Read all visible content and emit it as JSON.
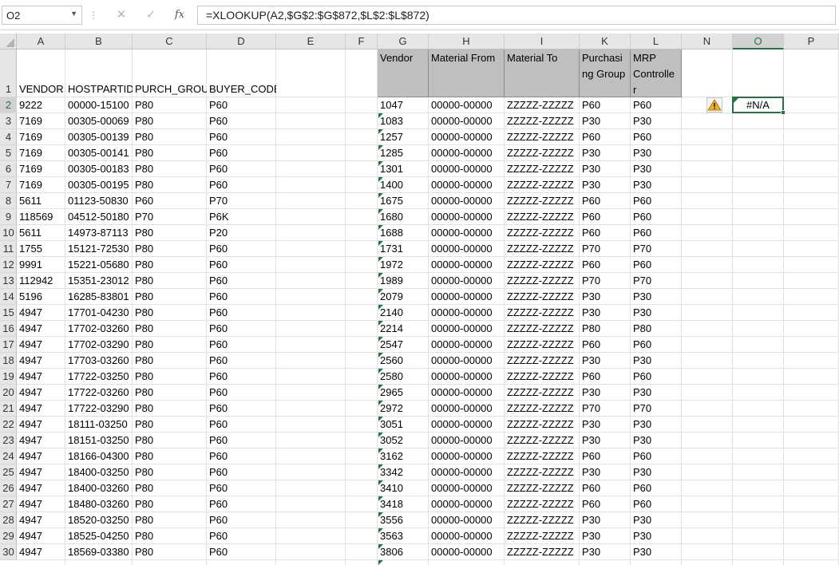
{
  "name_box": {
    "value": "O2",
    "dropdown_icon": "chevron-down-icon"
  },
  "formula_bar": {
    "separator": "⋮",
    "cancel_icon": "close-icon",
    "enter_icon": "check-icon",
    "fx_label": "fx",
    "formula": "=XLOOKUP(A2,$G$2:$G$872,$L$2:$L$872)"
  },
  "columns": [
    "A",
    "B",
    "C",
    "D",
    "E",
    "F",
    "G",
    "H",
    "I",
    "K",
    "L",
    "N",
    "O",
    "P"
  ],
  "active_column": "O",
  "active_row": 2,
  "row_numbers": [
    1,
    2,
    3,
    4,
    5,
    6,
    7,
    8,
    9,
    10,
    11,
    12,
    13,
    14,
    15,
    16,
    17,
    18,
    19,
    20,
    21,
    22,
    23,
    24,
    25,
    26,
    27,
    28,
    29,
    30
  ],
  "left_table": {
    "headers": [
      "VENDOR",
      "HOSTPARTID",
      "PURCH_GROUP",
      "BUYER_CODE"
    ],
    "rows": [
      [
        "9222",
        "00000-15100",
        "P80",
        "P60"
      ],
      [
        "7169",
        "00305-00069",
        "P80",
        "P60"
      ],
      [
        "7169",
        "00305-00139",
        "P80",
        "P60"
      ],
      [
        "7169",
        "00305-00141",
        "P80",
        "P60"
      ],
      [
        "7169",
        "00305-00183",
        "P80",
        "P60"
      ],
      [
        "7169",
        "00305-00195",
        "P80",
        "P60"
      ],
      [
        "5611",
        "01123-50830",
        "P60",
        "P70"
      ],
      [
        "118569",
        "04512-50180",
        "P70",
        "P6K"
      ],
      [
        "5611",
        "14973-87113",
        "P80",
        "P20"
      ],
      [
        "1755",
        "15121-72530",
        "P80",
        "P60"
      ],
      [
        "9991",
        "15221-05680",
        "P80",
        "P60"
      ],
      [
        "112942",
        "15351-23012",
        "P80",
        "P60"
      ],
      [
        "5196",
        "16285-83801",
        "P80",
        "P60"
      ],
      [
        "4947",
        "17701-04230",
        "P80",
        "P60"
      ],
      [
        "4947",
        "17702-03260",
        "P80",
        "P60"
      ],
      [
        "4947",
        "17702-03290",
        "P80",
        "P60"
      ],
      [
        "4947",
        "17703-03260",
        "P80",
        "P60"
      ],
      [
        "4947",
        "17722-03250",
        "P80",
        "P60"
      ],
      [
        "4947",
        "17722-03260",
        "P80",
        "P60"
      ],
      [
        "4947",
        "17722-03290",
        "P80",
        "P60"
      ],
      [
        "4947",
        "18111-03250",
        "P80",
        "P60"
      ],
      [
        "4947",
        "18151-03250",
        "P80",
        "P60"
      ],
      [
        "4947",
        "18166-04300",
        "P80",
        "P60"
      ],
      [
        "4947",
        "18400-03250",
        "P80",
        "P60"
      ],
      [
        "4947",
        "18400-03260",
        "P80",
        "P60"
      ],
      [
        "4947",
        "18480-03260",
        "P80",
        "P60"
      ],
      [
        "4947",
        "18520-03250",
        "P80",
        "P60"
      ],
      [
        "4947",
        "18525-04250",
        "P80",
        "P60"
      ],
      [
        "4947",
        "18569-03380",
        "P80",
        "P60"
      ]
    ]
  },
  "right_table": {
    "headers": [
      [
        "Vendor"
      ],
      [
        "Material From"
      ],
      [
        "Material To"
      ],
      [
        "Purchasi",
        "ng Group"
      ],
      [
        "MRP",
        "Controlle",
        "r"
      ]
    ],
    "rows": [
      [
        "1047",
        "00000-00000",
        "ZZZZZ-ZZZZZ",
        "P60",
        "P60"
      ],
      [
        "1083",
        "00000-00000",
        "ZZZZZ-ZZZZZ",
        "P30",
        "P30"
      ],
      [
        "1257",
        "00000-00000",
        "ZZZZZ-ZZZZZ",
        "P60",
        "P60"
      ],
      [
        "1285",
        "00000-00000",
        "ZZZZZ-ZZZZZ",
        "P30",
        "P30"
      ],
      [
        "1301",
        "00000-00000",
        "ZZZZZ-ZZZZZ",
        "P30",
        "P30"
      ],
      [
        "1400",
        "00000-00000",
        "ZZZZZ-ZZZZZ",
        "P30",
        "P30"
      ],
      [
        "1675",
        "00000-00000",
        "ZZZZZ-ZZZZZ",
        "P60",
        "P60"
      ],
      [
        "1680",
        "00000-00000",
        "ZZZZZ-ZZZZZ",
        "P60",
        "P60"
      ],
      [
        "1688",
        "00000-00000",
        "ZZZZZ-ZZZZZ",
        "P60",
        "P60"
      ],
      [
        "1731",
        "00000-00000",
        "ZZZZZ-ZZZZZ",
        "P70",
        "P70"
      ],
      [
        "1972",
        "00000-00000",
        "ZZZZZ-ZZZZZ",
        "P60",
        "P60"
      ],
      [
        "1989",
        "00000-00000",
        "ZZZZZ-ZZZZZ",
        "P70",
        "P70"
      ],
      [
        "2079",
        "00000-00000",
        "ZZZZZ-ZZZZZ",
        "P30",
        "P30"
      ],
      [
        "2140",
        "00000-00000",
        "ZZZZZ-ZZZZZ",
        "P30",
        "P30"
      ],
      [
        "2214",
        "00000-00000",
        "ZZZZZ-ZZZZZ",
        "P80",
        "P80"
      ],
      [
        "2547",
        "00000-00000",
        "ZZZZZ-ZZZZZ",
        "P60",
        "P60"
      ],
      [
        "2560",
        "00000-00000",
        "ZZZZZ-ZZZZZ",
        "P30",
        "P30"
      ],
      [
        "2580",
        "00000-00000",
        "ZZZZZ-ZZZZZ",
        "P60",
        "P60"
      ],
      [
        "2965",
        "00000-00000",
        "ZZZZZ-ZZZZZ",
        "P30",
        "P30"
      ],
      [
        "2972",
        "00000-00000",
        "ZZZZZ-ZZZZZ",
        "P70",
        "P70"
      ],
      [
        "3051",
        "00000-00000",
        "ZZZZZ-ZZZZZ",
        "P30",
        "P30"
      ],
      [
        "3052",
        "00000-00000",
        "ZZZZZ-ZZZZZ",
        "P30",
        "P30"
      ],
      [
        "3162",
        "00000-00000",
        "ZZZZZ-ZZZZZ",
        "P60",
        "P60"
      ],
      [
        "3342",
        "00000-00000",
        "ZZZZZ-ZZZZZ",
        "P30",
        "P30"
      ],
      [
        "3410",
        "00000-00000",
        "ZZZZZ-ZZZZZ",
        "P60",
        "P60"
      ],
      [
        "3418",
        "00000-00000",
        "ZZZZZ-ZZZZZ",
        "P60",
        "P60"
      ],
      [
        "3556",
        "00000-00000",
        "ZZZZZ-ZZZZZ",
        "P30",
        "P30"
      ],
      [
        "3563",
        "00000-00000",
        "ZZZZZ-ZZZZZ",
        "P30",
        "P30"
      ],
      [
        "3806",
        "00000-00000",
        "ZZZZZ-ZZZZZ",
        "P30",
        "P30"
      ]
    ]
  },
  "result_cell": {
    "ref": "O2",
    "value": "#N/A",
    "warning_icon": "warning-icon"
  },
  "colors": {
    "header_fill": "#bfbfbf",
    "accent": "#217346",
    "text_number_flag": "#1e7a3c",
    "warning": "#f2b01e"
  }
}
